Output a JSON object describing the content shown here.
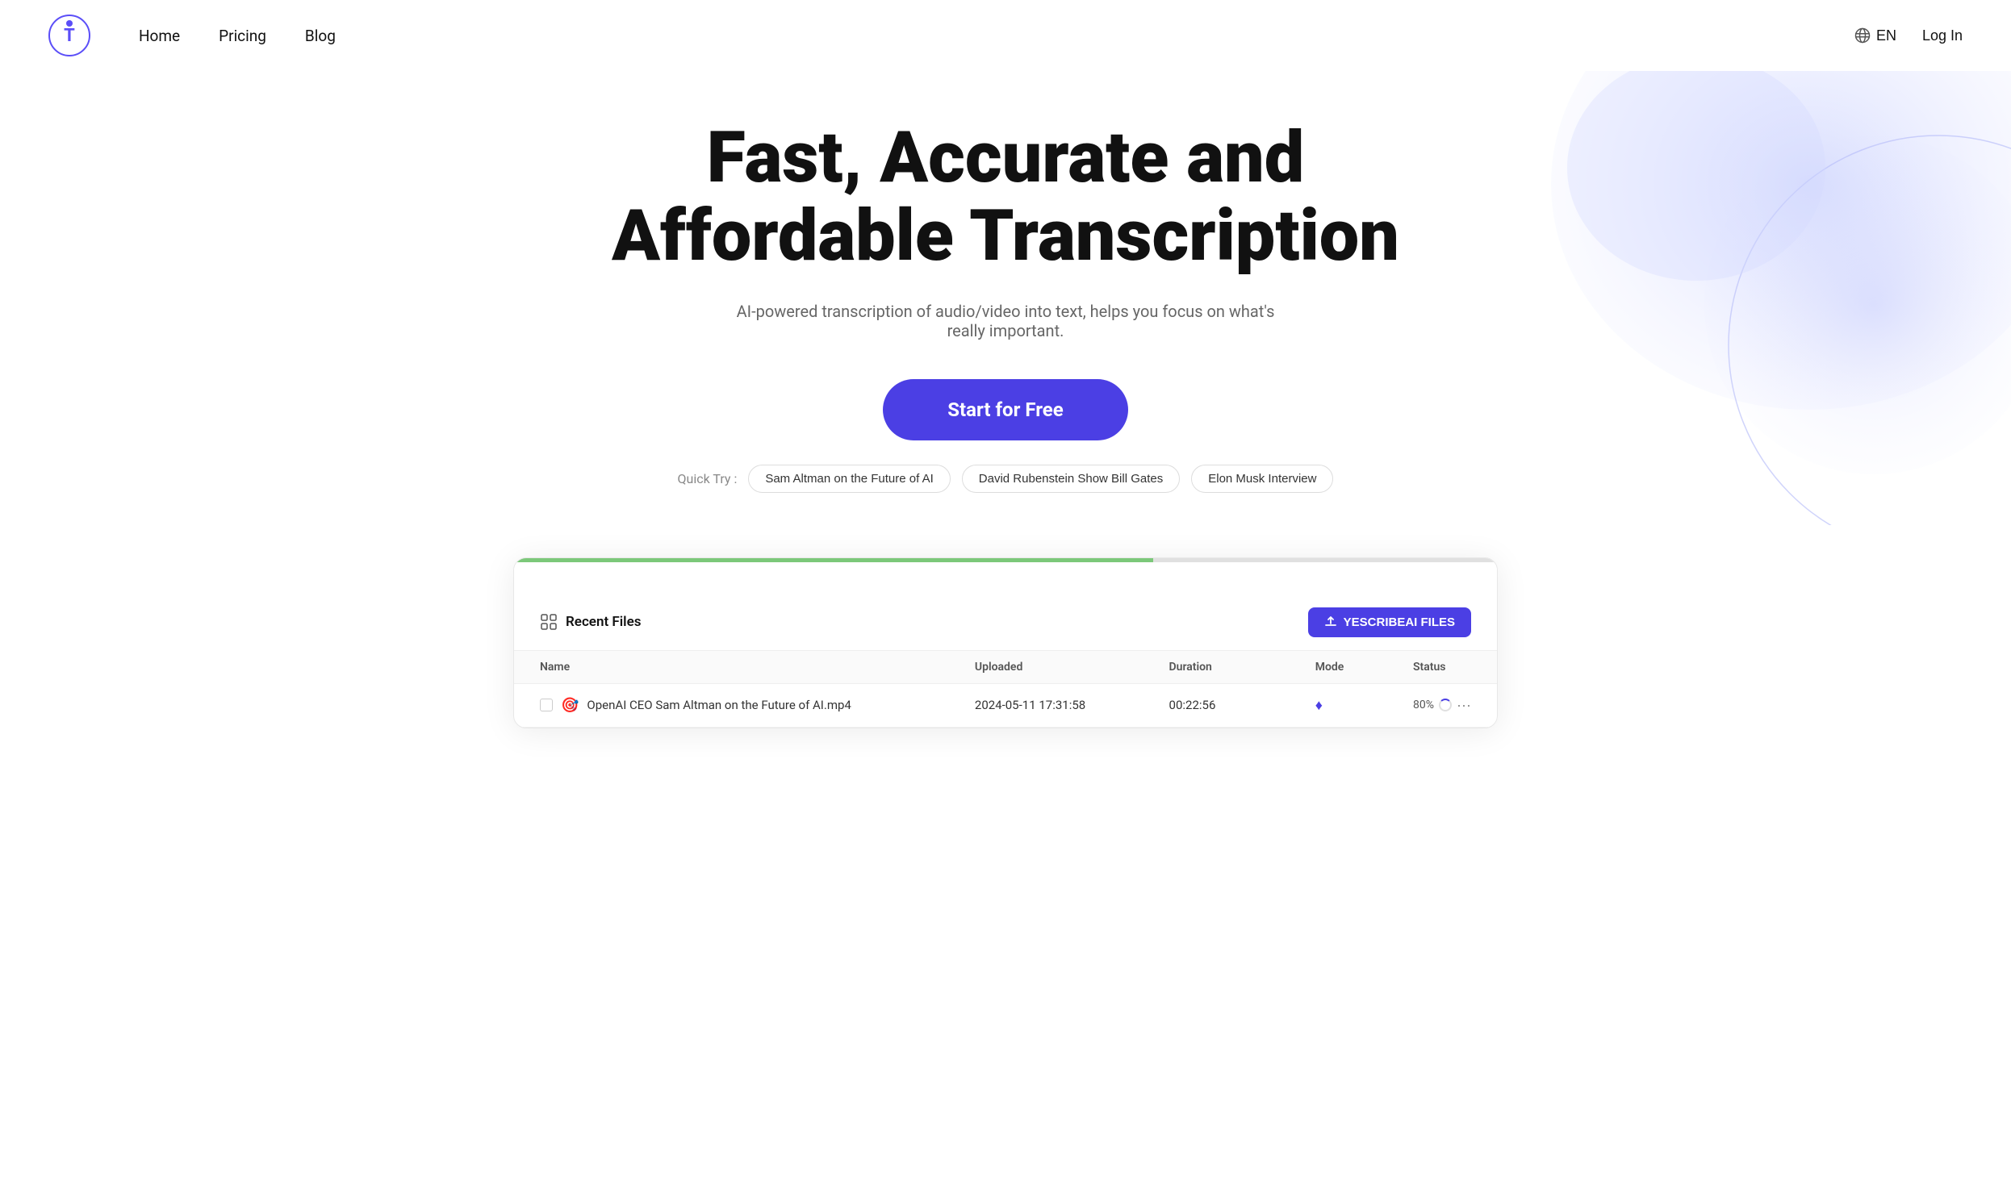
{
  "nav": {
    "logo_letter": "T",
    "links": [
      {
        "label": "Home",
        "href": "#"
      },
      {
        "label": "Pricing",
        "href": "#"
      },
      {
        "label": "Blog",
        "href": "#"
      }
    ],
    "lang_label": "EN",
    "login_label": "Log In"
  },
  "hero": {
    "heading_line1": "Fast, Accurate and",
    "heading_line2": "Affordable Transcription",
    "subtitle": "AI-powered transcription of audio/video into text, helps you focus on what's really important.",
    "cta_label": "Start for Free",
    "quick_try_label": "Quick Try :",
    "chips": [
      {
        "label": "Sam Altman on the Future of AI"
      },
      {
        "label": "David Rubenstein Show Bill Gates"
      },
      {
        "label": "Elon Musk Interview"
      }
    ]
  },
  "dashboard": {
    "recent_files_label": "Recent Files",
    "upload_btn_label": "YESCRIBEAI FILES",
    "progress_fill_pct": 65,
    "table": {
      "headers": [
        "Name",
        "Uploaded",
        "Duration",
        "Mode",
        "Status"
      ],
      "rows": [
        {
          "name": "OpenAI CEO Sam Altman on the Future of AI.mp4",
          "emoji": "🎯",
          "uploaded": "2024-05-11 17:31:58",
          "duration": "00:22:56",
          "mode": "♦",
          "status": "80%",
          "status_loading": true,
          "dots": "···"
        }
      ]
    }
  }
}
